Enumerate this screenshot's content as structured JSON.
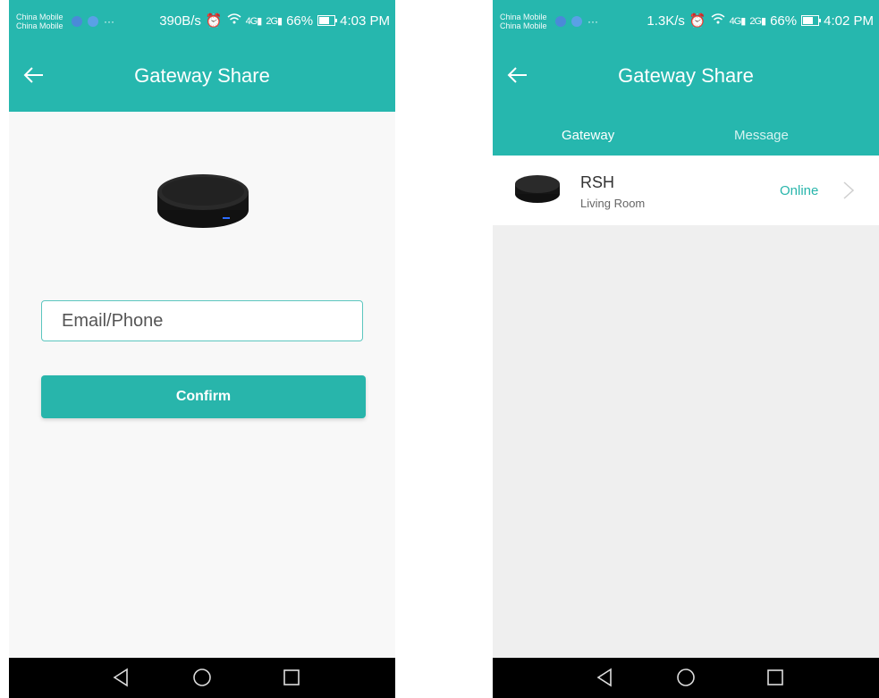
{
  "left_screen": {
    "status_bar": {
      "carrier_1": "China Mobile",
      "carrier_2": "China Mobile",
      "net_speed": "390B/s",
      "signal_1": "4G",
      "signal_2": "2G",
      "battery": "66%",
      "time": "4:03 PM"
    },
    "app_bar": {
      "title": "Gateway Share"
    },
    "email_input": {
      "placeholder": "Email/Phone"
    },
    "confirm_button": {
      "label": "Confirm"
    }
  },
  "right_screen": {
    "status_bar": {
      "carrier_1": "China Mobile",
      "carrier_2": "China Mobile",
      "net_speed": "1.3K/s",
      "signal_1": "4G",
      "signal_2": "2G",
      "battery": "66%",
      "time": "4:02 PM"
    },
    "app_bar": {
      "title": "Gateway Share"
    },
    "tabs": [
      {
        "label": "Gateway",
        "active": true
      },
      {
        "label": "Message",
        "active": false
      }
    ],
    "gateway_list": [
      {
        "name": "RSH",
        "room": "Living Room",
        "status": "Online"
      }
    ]
  },
  "colors": {
    "accent": "#26b7ae",
    "online_text": "#28b5ab",
    "navbar": "#000000"
  },
  "icons": {
    "back": "arrow-left-icon",
    "nav_back": "triangle-back-icon",
    "nav_home": "circle-home-icon",
    "nav_recents": "square-recents-icon",
    "chevron": "chevron-right-icon"
  }
}
